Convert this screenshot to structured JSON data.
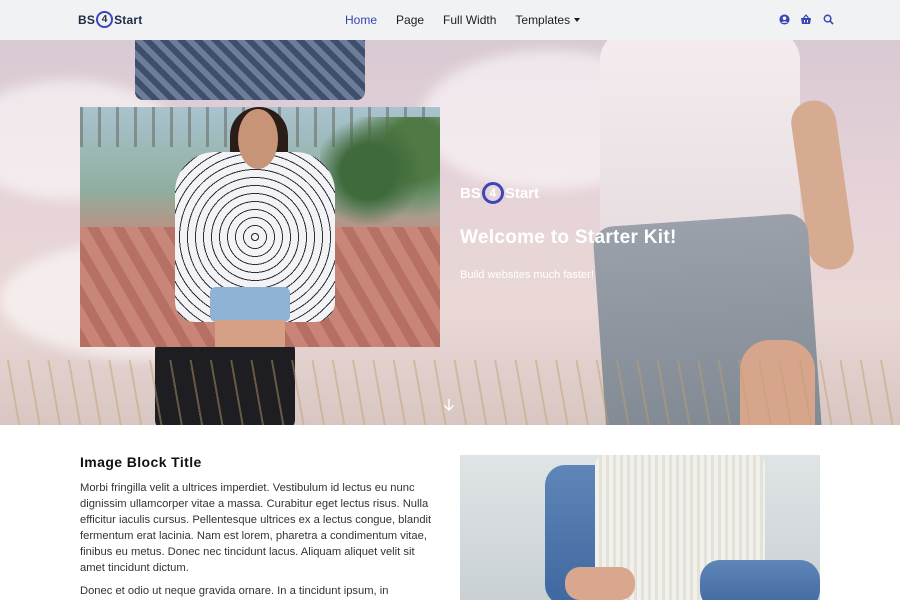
{
  "nav": {
    "brand_left": "BS",
    "brand_num": "4",
    "brand_right": "Start",
    "links": [
      {
        "label": "Home"
      },
      {
        "label": "Page"
      },
      {
        "label": "Full Width"
      },
      {
        "label": "Templates"
      }
    ],
    "icons": [
      "user-icon",
      "basket-icon",
      "search-icon"
    ]
  },
  "hero": {
    "brand_left": "BS",
    "brand_num": "4",
    "brand_right": "Start",
    "title": "Welcome to Starter Kit!",
    "subtitle": "Build websites much faster!"
  },
  "content": {
    "title": "Image Block Title",
    "paragraph1": "Morbi fringilla velit a ultrices imperdiet. Vestibulum id lectus eu nunc dignissim ullamcorper vitae a massa. Curabitur eget lectus risus. Nulla efficitur iaculis cursus. Pellentesque ultrices ex a lectus congue, blandit fermentum erat lacinia. Nam est lorem, pharetra a condimentum vitae, finibus eu metus. Donec nec tincidunt lacus. Aliquam aliquet velit sit amet tincidunt dictum.",
    "paragraph2": "Donec et odio ut neque gravida ornare. In a tincidunt ipsum, in"
  },
  "colors": {
    "accent": "#3b44b3",
    "navbar_bg": "#f1f2f4"
  }
}
